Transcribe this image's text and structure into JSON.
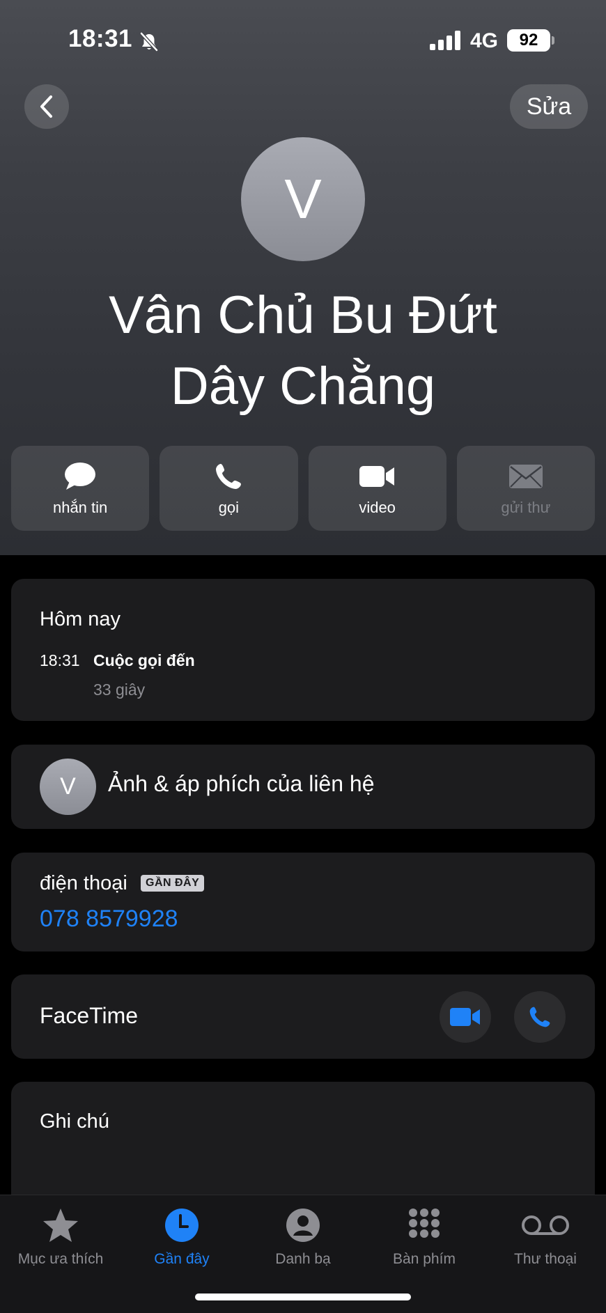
{
  "status_bar": {
    "time": "18:31",
    "network": "4G",
    "battery": "92"
  },
  "nav": {
    "edit_label": "Sửa"
  },
  "contact": {
    "initial": "V",
    "name_line1": "Vân Chủ Bu Đứt",
    "name_line2": "Dây Chằng"
  },
  "actions": [
    {
      "label": "nhắn tin",
      "icon": "message-bubble-icon"
    },
    {
      "label": "gọi",
      "icon": "phone-icon"
    },
    {
      "label": "video",
      "icon": "video-camera-icon"
    },
    {
      "label": "gửi thư",
      "icon": "mail-icon"
    }
  ],
  "recent": {
    "day": "Hôm nay",
    "time": "18:31",
    "type": "Cuộc gọi đến",
    "duration": "33 giây"
  },
  "photo_poster": {
    "initial": "V",
    "label": "Ảnh & áp phích của liên hệ"
  },
  "phone": {
    "label": "điện thoại",
    "badge": "GẦN ĐÂY",
    "number": "078 8579928"
  },
  "facetime": {
    "label": "FaceTime"
  },
  "notes": {
    "label": "Ghi chú"
  },
  "tabs": [
    {
      "label": "Mục ưa thích",
      "icon": "star-icon"
    },
    {
      "label": "Gần đây",
      "icon": "clock-icon"
    },
    {
      "label": "Danh bạ",
      "icon": "person-icon"
    },
    {
      "label": "Bàn phím",
      "icon": "keypad-icon"
    },
    {
      "label": "Thư thoại",
      "icon": "voicemail-icon"
    }
  ],
  "colors": {
    "accent": "#1f82f7",
    "card": "#1c1c1e",
    "background": "#000000"
  }
}
